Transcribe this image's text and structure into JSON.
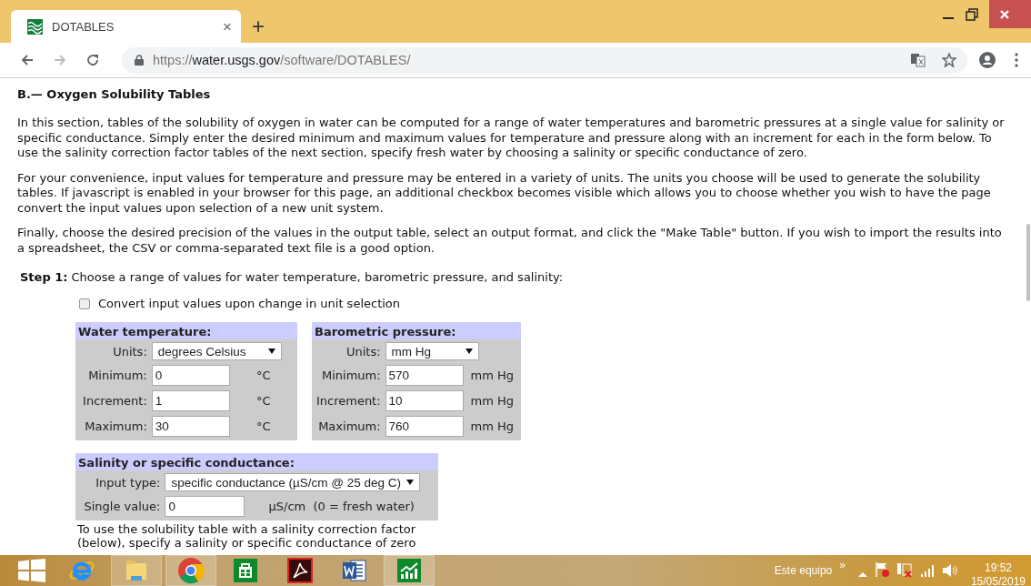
{
  "browser": {
    "tab": {
      "title": "DOTABLES",
      "close": "×",
      "new_tab": "+"
    },
    "url": {
      "scheme": "https://",
      "host": "water.usgs.gov",
      "path": "/software/DOTABLES/"
    }
  },
  "page": {
    "heading": "B.— Oxygen Solubility Tables",
    "paragraphs": [
      "In this section, tables of the solubility of oxygen in water can be computed for a range of water temperatures and barometric pressures at a single value for salinity or specific conductance. Simply enter the desired minimum and maximum values for temperature and pressure along with an increment for each in the form below. To use the salinity correction factor tables of the next section, specify fresh water by choosing a salinity or specific conductance of zero.",
      "For your convenience, input values for temperature and pressure may be entered in a variety of units. The units you choose will be used to generate the solubility tables. If javascript is enabled in your browser for this page, an additional checkbox becomes visible which allows you to choose whether you wish to have the page convert the input values upon selection of a new unit system.",
      "Finally, choose the desired precision of the values in the output table, select an output format, and click the \"Make Table\" button. If you wish to import the results into a spreadsheet, the CSV or comma-separated text file is a good option."
    ],
    "step": {
      "label": "Step 1:",
      "text": "Choose a range of values for water temperature, barometric pressure, and salinity:"
    },
    "convert": {
      "label": "Convert input values upon change in unit selection",
      "checked": false
    },
    "panels": [
      {
        "title": "Water temperature:",
        "rows": [
          {
            "kind": "select",
            "label": "Units:",
            "value": "degrees Celsius"
          },
          {
            "kind": "input",
            "label": "Minimum:",
            "value": "0",
            "unit": "°C"
          },
          {
            "kind": "input",
            "label": "Increment:",
            "value": "1",
            "unit": "°C"
          },
          {
            "kind": "input",
            "label": "Maximum:",
            "value": "30",
            "unit": "°C"
          }
        ]
      },
      {
        "title": "Barometric pressure:",
        "rows": [
          {
            "kind": "select",
            "label": "Units:",
            "value": "mm Hg"
          },
          {
            "kind": "input",
            "label": "Minimum:",
            "value": "570",
            "unit": "mm Hg"
          },
          {
            "kind": "input",
            "label": "Increment:",
            "value": "10",
            "unit": "mm Hg"
          },
          {
            "kind": "input",
            "label": "Maximum:",
            "value": "760",
            "unit": "mm Hg"
          }
        ]
      }
    ],
    "salinity": {
      "title": "Salinity or specific conductance:",
      "rows": [
        {
          "kind": "select",
          "label": "Input type:",
          "value": "specific conductance (µS/cm @ 25 deg C)"
        },
        {
          "kind": "input",
          "label": "Single value:",
          "value": "0",
          "unit": "µS/cm",
          "hint": "(0 = fresh water)"
        }
      ]
    },
    "note": "To use the solubility table with a salinity correction factor (below), specify a salinity or specific conductance of zero"
  },
  "taskbar": {
    "apps": [
      {
        "kind": "ie",
        "running": false
      },
      {
        "kind": "explorer",
        "running": true
      },
      {
        "kind": "chrome",
        "running": true
      },
      {
        "kind": "store",
        "running": false
      },
      {
        "kind": "pdf",
        "running": false
      },
      {
        "kind": "word",
        "running": false
      },
      {
        "kind": "chart",
        "running": true
      }
    ],
    "location": "Este equipo",
    "chevron": "»",
    "time": "19:52",
    "date": "15/05/2019"
  }
}
